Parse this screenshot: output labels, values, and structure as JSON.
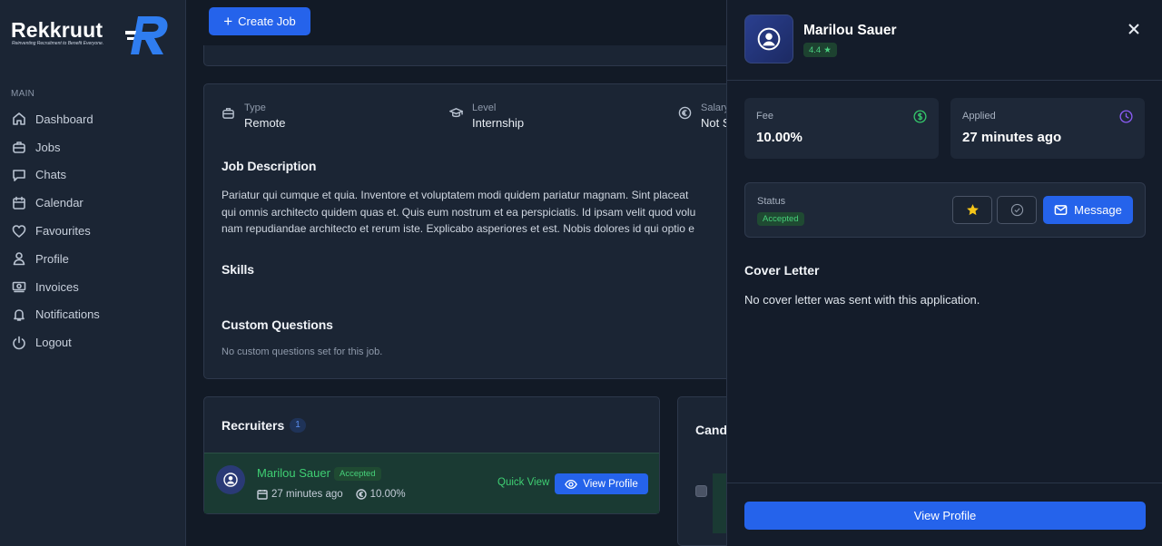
{
  "brand": {
    "name": "Rekkruut",
    "tagline": "Reinventing Recruitment to Benefit Everyone.",
    "accent": "#2563eb"
  },
  "sidebar": {
    "section_label": "MAIN",
    "items": [
      {
        "label": "Dashboard",
        "icon": "home-icon"
      },
      {
        "label": "Jobs",
        "icon": "briefcase-icon"
      },
      {
        "label": "Chats",
        "icon": "chat-icon"
      },
      {
        "label": "Calendar",
        "icon": "calendar-icon"
      },
      {
        "label": "Favourites",
        "icon": "heart-icon"
      },
      {
        "label": "Profile",
        "icon": "user-icon"
      },
      {
        "label": "Invoices",
        "icon": "money-icon"
      },
      {
        "label": "Notifications",
        "icon": "bell-icon"
      },
      {
        "label": "Logout",
        "icon": "logout-icon"
      }
    ]
  },
  "topbar": {
    "create_job_label": "Create Job"
  },
  "job": {
    "meta": [
      {
        "label": "Type",
        "value": "Remote"
      },
      {
        "label": "Level",
        "value": "Internship"
      },
      {
        "label": "Salary",
        "value": "Not S"
      }
    ],
    "description_title": "Job Description",
    "description_lines": [
      "Pariatur qui cumque et quia. Inventore et voluptatem modi quidem pariatur magnam. Sint placeat",
      "qui omnis architecto quidem quas et. Quis eum nostrum et ea perspiciatis. Id ipsam velit quod volu",
      "nam repudiandae architecto et rerum iste. Explicabo asperiores et est. Nobis dolores id qui optio e"
    ],
    "skills_title": "Skills",
    "custom_questions_title": "Custom Questions",
    "custom_questions_empty": "No custom questions set for this job."
  },
  "recruiters": {
    "title": "Recruiters",
    "count": "1",
    "row": {
      "name": "Marilou Sauer",
      "status": "Accepted",
      "applied": "27 minutes ago",
      "fee": "10.00%",
      "quick_view": "Quick View",
      "view_profile": "View Profile"
    }
  },
  "candidates": {
    "title": "Cand"
  },
  "panel": {
    "name": "Marilou Sauer",
    "rating": "4.4",
    "fee_label": "Fee",
    "fee_value": "10.00%",
    "applied_label": "Applied",
    "applied_value": "27 minutes ago",
    "status_label": "Status",
    "status_value": "Accepted",
    "message_label": "Message",
    "cover_title": "Cover Letter",
    "cover_text": "No cover letter was sent with this application.",
    "view_profile_label": "View Profile"
  }
}
